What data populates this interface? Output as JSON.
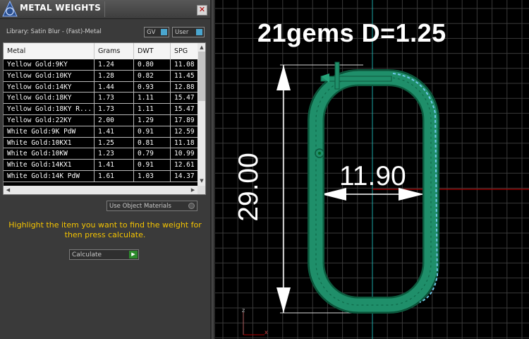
{
  "panel": {
    "title": "METAL WEIGHTS",
    "close_glyph": "✕",
    "library_label": "Library: Satin Blur - (Fast)-Metal",
    "buttons": {
      "gv": "GV",
      "user": "User"
    },
    "table": {
      "headers": [
        "Metal",
        "Grams",
        "DWT",
        "SPG"
      ],
      "rows": [
        [
          "Yellow Gold:9KY",
          "1.24",
          "0.80",
          "11.08"
        ],
        [
          "Yellow Gold:10KY",
          "1.28",
          "0.82",
          "11.45"
        ],
        [
          "Yellow Gold:14KY",
          "1.44",
          "0.93",
          "12.88"
        ],
        [
          "Yellow Gold:18KY",
          "1.73",
          "1.11",
          "15.47"
        ],
        [
          "Yellow Gold:18KY R...",
          "1.73",
          "1.11",
          "15.47"
        ],
        [
          "Yellow Gold:22KY",
          "2.00",
          "1.29",
          "17.89"
        ],
        [
          "White Gold:9K PdW",
          "1.41",
          "0.91",
          "12.59"
        ],
        [
          "White Gold:10KX1",
          "1.25",
          "0.81",
          "11.18"
        ],
        [
          "White Gold:10KW",
          "1.23",
          "0.79",
          "10.99"
        ],
        [
          "White Gold:14KX1",
          "1.41",
          "0.91",
          "12.61"
        ],
        [
          "White Gold:14K PdW",
          "1.61",
          "1.03",
          "14.37"
        ]
      ]
    },
    "use_object_materials": "Use Object Materials",
    "hint": "Highlight the item you want to find the weight for then press calculate.",
    "calculate": "Calculate"
  },
  "viewport": {
    "title": "21gems D=1.25",
    "width_dimension": "11.90",
    "height_dimension": "29.00",
    "axis_labels": {
      "z": "z",
      "x": "x"
    }
  },
  "colors": {
    "hint_text": "#f5c400",
    "model": "#1f8f6a",
    "grid": "#3a3a3a",
    "axis_red": "#b00000",
    "axis_cyan": "#1aa5a5"
  }
}
